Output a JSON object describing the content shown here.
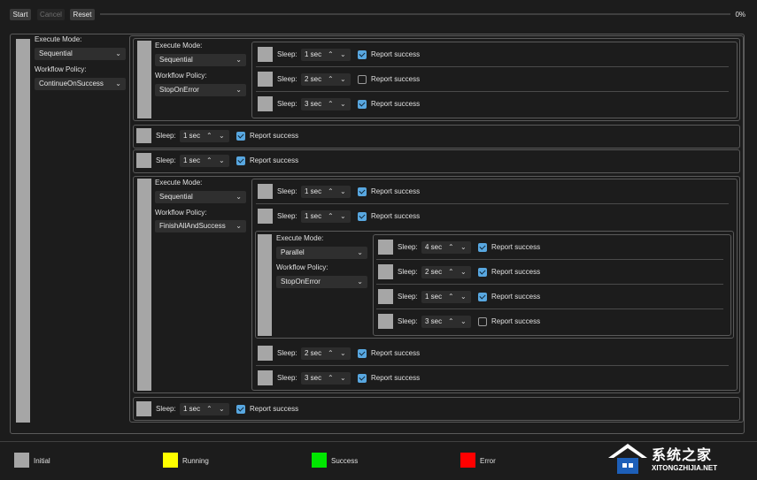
{
  "toolbar": {
    "start": "Start",
    "cancel": "Cancel",
    "reset": "Reset",
    "progress_text": "0%",
    "progress_value": 0
  },
  "labels": {
    "execute_mode": "Execute Mode:",
    "workflow_policy": "Workflow Policy:",
    "sleep": "Sleep:",
    "report_success": "Report success"
  },
  "root": {
    "execute_mode": "Sequential",
    "workflow_policy": "ContinueOnSuccess"
  },
  "group1": {
    "execute_mode": "Sequential",
    "workflow_policy": "StopOnError",
    "rows": [
      {
        "sleep": "1 sec",
        "report": true
      },
      {
        "sleep": "2 sec",
        "report": false
      },
      {
        "sleep": "3 sec",
        "report": true
      }
    ]
  },
  "root_rows_a": [
    {
      "sleep": "1 sec",
      "report": true
    },
    {
      "sleep": "1 sec",
      "report": true
    }
  ],
  "group2": {
    "execute_mode": "Sequential",
    "workflow_policy": "FinishAllAndSuccess",
    "rows_top": [
      {
        "sleep": "1 sec",
        "report": true
      },
      {
        "sleep": "1 sec",
        "report": true
      }
    ],
    "inner": {
      "execute_mode": "Parallel",
      "workflow_policy": "StopOnError",
      "rows": [
        {
          "sleep": "4 sec",
          "report": true
        },
        {
          "sleep": "2 sec",
          "report": true
        },
        {
          "sleep": "1 sec",
          "report": true
        },
        {
          "sleep": "3 sec",
          "report": false
        }
      ]
    },
    "rows_bottom": [
      {
        "sleep": "2 sec",
        "report": true
      },
      {
        "sleep": "3 sec",
        "report": true
      }
    ]
  },
  "root_rows_b": [
    {
      "sleep": "1 sec",
      "report": true
    }
  ],
  "legend": [
    {
      "label": "Initial",
      "color": "#a6a6a6"
    },
    {
      "label": "Running",
      "color": "#ffff00"
    },
    {
      "label": "Success",
      "color": "#00e600"
    },
    {
      "label": "Error",
      "color": "#ff0000"
    }
  ],
  "watermark": {
    "title": "系统之家",
    "url": "XITONGZHIJIA.NET"
  },
  "colors": {
    "accent": "#58a7e0",
    "status_initial": "#a6a6a6",
    "background": "#1c1c1c"
  }
}
